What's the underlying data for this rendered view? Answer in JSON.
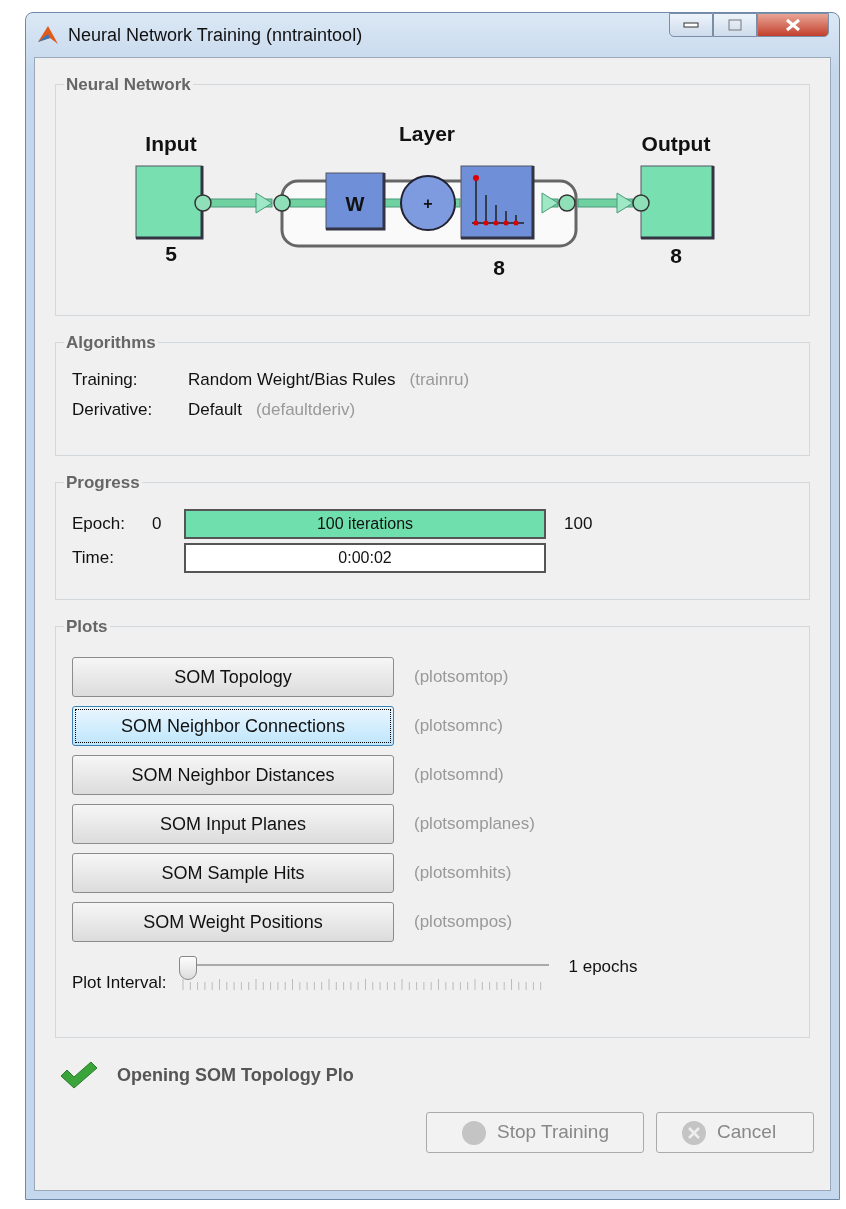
{
  "window": {
    "title": "Neural Network Training (nntraintool)"
  },
  "network": {
    "title": "Neural Network",
    "input": {
      "label": "Input",
      "size": "5"
    },
    "layer": {
      "label": "Layer",
      "size": "8",
      "weight": "W",
      "sum": "+"
    },
    "output": {
      "label": "Output",
      "size": "8"
    }
  },
  "algorithms": {
    "title": "Algorithms",
    "rows": [
      {
        "label": "Training:",
        "value": "Random Weight/Bias Rules",
        "function": "(trainru)"
      },
      {
        "label": "Derivative:",
        "value": "Default",
        "function": "(defaultderiv)"
      }
    ]
  },
  "progress": {
    "title": "Progress",
    "rows": [
      {
        "kind": "bar",
        "label": "Epoch:",
        "start": "0",
        "text": "100 iterations",
        "level": 1,
        "end": "100"
      },
      {
        "kind": "field",
        "label": "Time:",
        "text": "0:00:02"
      }
    ]
  },
  "plots": {
    "title": "Plots",
    "buttons": [
      {
        "label": "SOM Topology",
        "function": "(plotsomtop)",
        "selected": false
      },
      {
        "label": "SOM Neighbor Connections",
        "function": "(plotsomnc)",
        "selected": true
      },
      {
        "label": "SOM Neighbor Distances",
        "function": "(plotsomnd)",
        "selected": false
      },
      {
        "label": "SOM Input Planes",
        "function": "(plotsomplanes)",
        "selected": false
      },
      {
        "label": "SOM Sample Hits",
        "function": "(plotsomhits)",
        "selected": false
      },
      {
        "label": "SOM Weight Positions",
        "function": "(plotsompos)",
        "selected": false
      }
    ],
    "interval": {
      "label": "Plot Interval:",
      "level": 0,
      "reading": "1 epochs"
    }
  },
  "status": {
    "text": "Opening SOM Topology Plo"
  },
  "buttons": [
    {
      "kind": "stop",
      "label": "Stop Training",
      "disabled": true
    },
    {
      "kind": "cancel",
      "label": "Cancel",
      "disabled": true
    }
  ]
}
